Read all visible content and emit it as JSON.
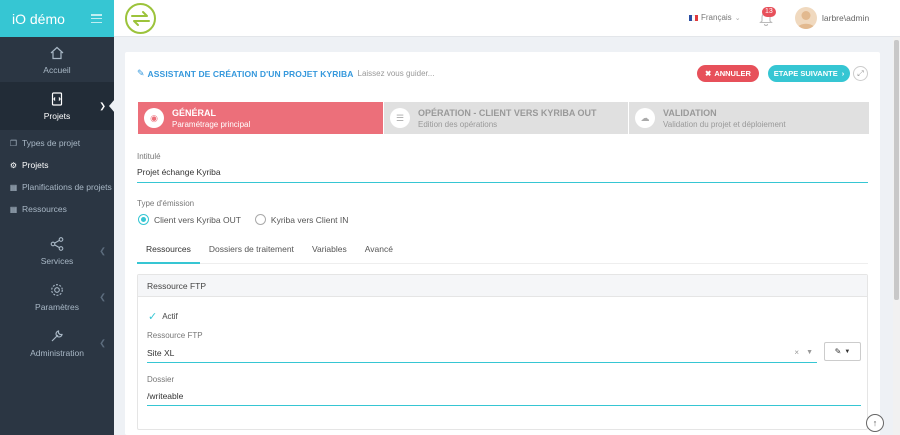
{
  "app": {
    "name": "iO démo"
  },
  "sidebar": {
    "main": [
      {
        "label": "Accueil",
        "icon": "home-icon"
      },
      {
        "label": "Projets",
        "icon": "project-icon"
      }
    ],
    "sub": [
      {
        "label": "Types de projet",
        "icon": "copy-icon"
      },
      {
        "label": "Projets",
        "icon": "gear-icon"
      },
      {
        "label": "Planifications de projets",
        "icon": "calendar-icon"
      },
      {
        "label": "Ressources",
        "icon": "grid-icon"
      }
    ],
    "sections": [
      {
        "label": "Services",
        "icon": "share-icon"
      },
      {
        "label": "Paramètres",
        "icon": "settings-icon"
      },
      {
        "label": "Administration",
        "icon": "wrench-icon"
      }
    ]
  },
  "topbar": {
    "language": "Français",
    "notification_count": "13",
    "user": "larbre\\admin"
  },
  "wizard": {
    "title": "ASSISTANT DE CRÉATION D'UN PROJET KYRIBA",
    "subtitle": "Laissez vous guider...",
    "cancel_label": "ANNULER",
    "next_label": "ETAPE SUIVANTE",
    "steps": [
      {
        "title": "GÉNÉRAL",
        "desc": "Paramétrage principal"
      },
      {
        "title": "OPÉRATION - CLIENT VERS KYRIBA OUT",
        "desc": "Edition des opérations"
      },
      {
        "title": "VALIDATION",
        "desc": "Validation du projet et déploiement"
      }
    ]
  },
  "form": {
    "intitule_label": "Intitulé",
    "intitule_value": "Projet échange Kyriba",
    "type_label": "Type d'émission",
    "type_options": [
      "Client vers Kyriba OUT",
      "Kyriba vers Client IN"
    ],
    "type_selected": "Client vers Kyriba OUT"
  },
  "tabs": [
    "Ressources",
    "Dossiers de traitement",
    "Variables",
    "Avancé"
  ],
  "resource_box": {
    "title": "Ressource FTP",
    "active_label": "Actif",
    "ftp_label": "Ressource FTP",
    "ftp_value": "Site XL",
    "dossier_label": "Dossier",
    "dossier_value": "/writeable"
  },
  "colors": {
    "accent": "#36c6d3",
    "danger": "#e7505a",
    "step_active": "#ec6f7a",
    "sidebar": "#2b3643",
    "title_blue": "#3598dc"
  }
}
